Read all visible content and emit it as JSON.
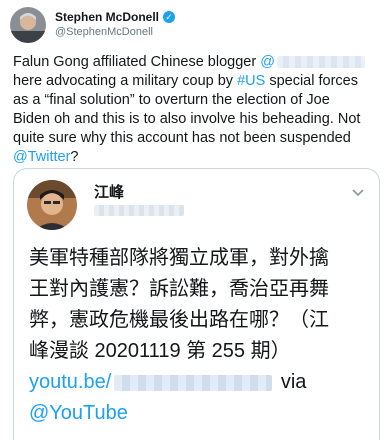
{
  "author": {
    "name": "Stephen McDonell",
    "handle": "@StephenMcDonell",
    "verified_icon": "verified-badge-icon",
    "avatar_icon": "avatar-photo"
  },
  "tweet": {
    "line1_pre": "Falun Gong affiliated Chinese blogger ",
    "line1_at": "@",
    "line2_pre": "here advocating a military coup by ",
    "line2_tag": "#US",
    "line2_post": " special forces",
    "line3": "as a “final solution” to overturn the election of Joe",
    "line4": "Biden oh and this is to also involve his beheading. Not",
    "line5": "quite sure why this account has not been suspended",
    "line6_mention": "@Twitter",
    "line6_post": "?"
  },
  "quoted": {
    "name": "江峰",
    "line1": "美軍特種部隊將獨立成軍，對外擒",
    "line2": "王對內護憲？訴訟難，喬治亞再舞",
    "line3": "弊，憲政危機最後出路在哪？（江",
    "line4": "峰漫談 20201119 第 255 期）",
    "link_pre": "youtu.be/",
    "link_post": " via",
    "via_mention": "@YouTube"
  },
  "colors": {
    "link": "#1da1f2",
    "text": "#14171a",
    "secondary": "#657786",
    "border": "#ccd6dd"
  }
}
